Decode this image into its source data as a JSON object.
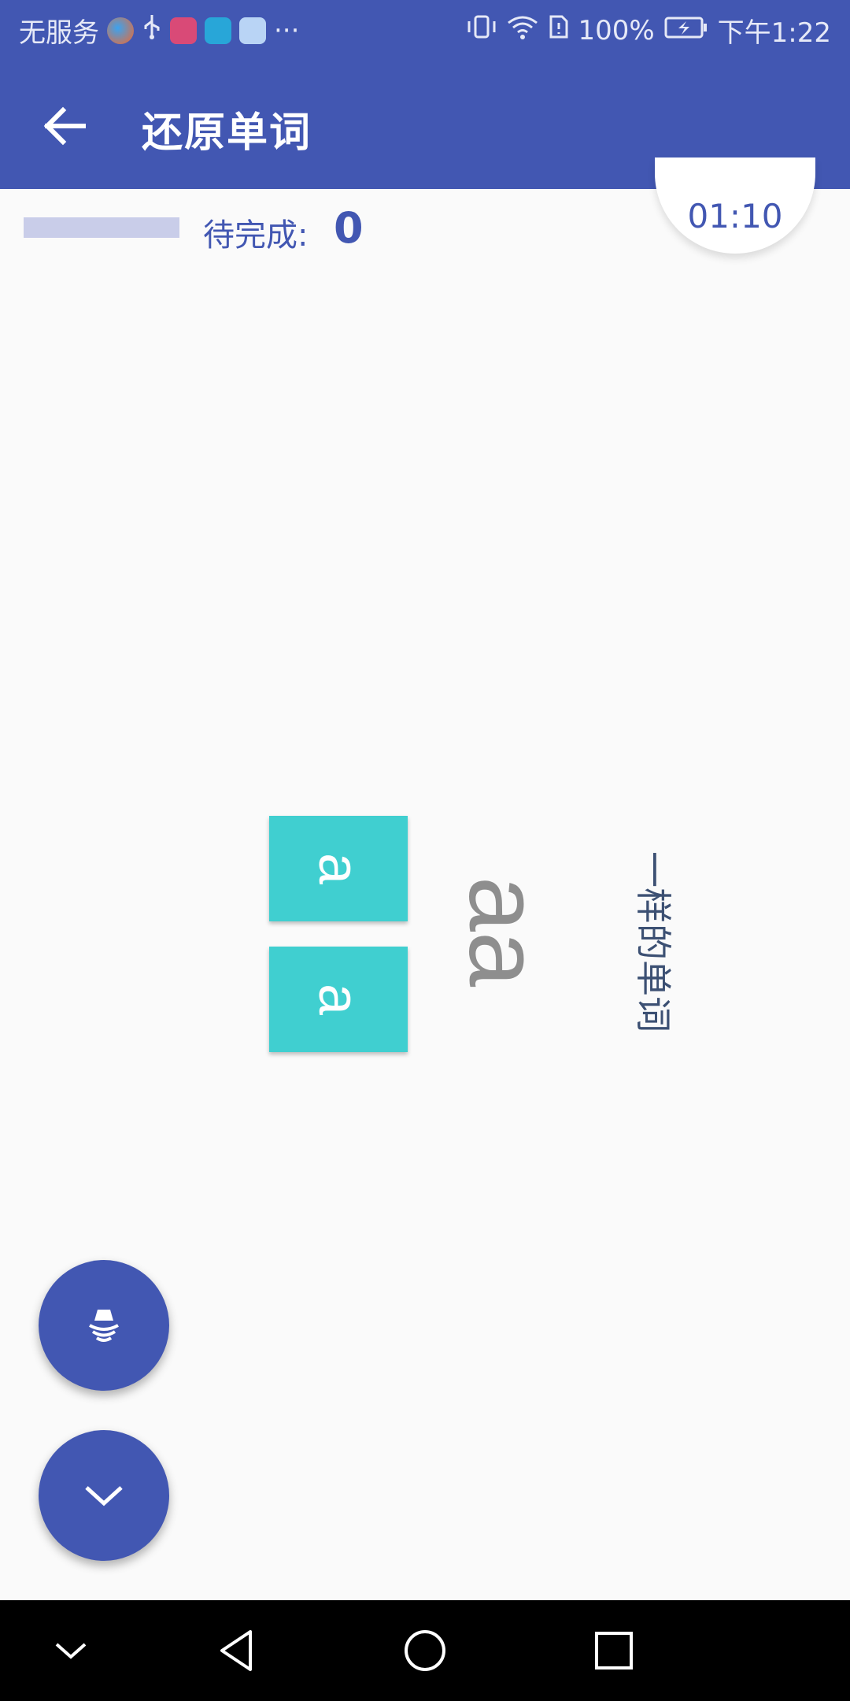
{
  "status_bar": {
    "carrier": "无服务",
    "more": "···",
    "battery": "100%",
    "time": "下午1:22",
    "notification_icons": [
      "browser-icon",
      "usb-icon",
      "shop-icon",
      "book-icon",
      "cloud-icon"
    ],
    "system_icons": [
      "vibrate-icon",
      "wifi-icon",
      "sim-icon",
      "battery-charging-icon"
    ]
  },
  "app_bar": {
    "title": "还原单词",
    "back_icon": "arrow-left-icon"
  },
  "progress": {
    "pending_label": "待完成:",
    "pending_count": "0",
    "value": 0
  },
  "timer": {
    "text": "01:10"
  },
  "puzzle": {
    "tiles": [
      "a",
      "a"
    ],
    "word": "aa",
    "hint": "一样的单词"
  },
  "fabs": {
    "speaker_icon": "speaker-icon",
    "collapse_icon": "chevron-down-icon"
  },
  "nav_bar": {
    "icons": [
      "nav-hide-icon",
      "nav-back-icon",
      "nav-home-icon",
      "nav-recents-icon"
    ]
  },
  "colors": {
    "primary": "#4257b2",
    "tile": "#40cfd0",
    "progress_track": "#c9cde9",
    "hint_text": "#3c5073",
    "word_text": "#8e8e8e"
  }
}
